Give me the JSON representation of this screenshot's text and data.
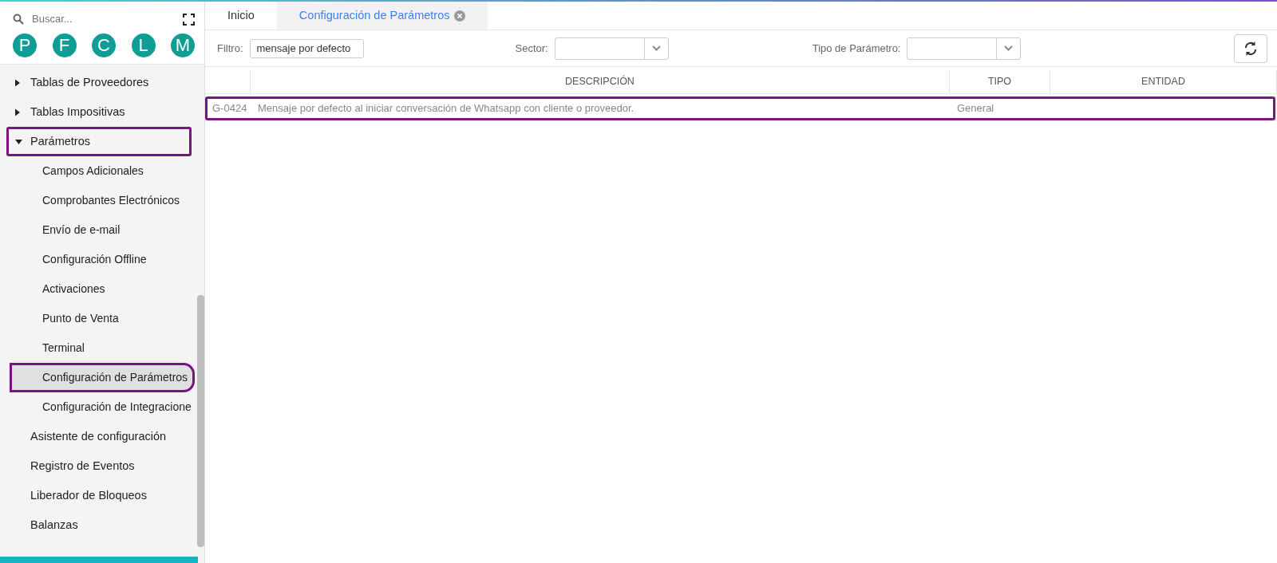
{
  "sidebar": {
    "search": {
      "placeholder": "Buscar..."
    },
    "shortcuts": [
      "P",
      "F",
      "C",
      "L",
      "M"
    ],
    "items": [
      {
        "label": "Tablas de Proveedores",
        "kind": "group",
        "expanded": false,
        "highlighted": false
      },
      {
        "label": "Tablas Impositivas",
        "kind": "group",
        "expanded": false,
        "highlighted": false
      },
      {
        "label": "Parámetros",
        "kind": "group",
        "expanded": true,
        "highlighted": true,
        "children": [
          {
            "label": "Campos Adicionales",
            "selected": false,
            "highlighted": false
          },
          {
            "label": "Comprobantes Electrónicos",
            "selected": false,
            "highlighted": false
          },
          {
            "label": "Envío de e-mail",
            "selected": false,
            "highlighted": false
          },
          {
            "label": "Configuración Offline",
            "selected": false,
            "highlighted": false
          },
          {
            "label": "Activaciones",
            "selected": false,
            "highlighted": false
          },
          {
            "label": "Punto de Venta",
            "selected": false,
            "highlighted": false
          },
          {
            "label": "Terminal",
            "selected": false,
            "highlighted": false
          },
          {
            "label": "Configuración de Parámetros",
            "selected": true,
            "highlighted": true
          },
          {
            "label": "Configuración de Integracione",
            "selected": false,
            "highlighted": false
          }
        ]
      },
      {
        "label": "Asistente de configuración",
        "kind": "link",
        "highlighted": false
      },
      {
        "label": "Registro de Eventos",
        "kind": "link",
        "highlighted": false
      },
      {
        "label": "Liberador de Bloqueos",
        "kind": "link",
        "highlighted": false
      },
      {
        "label": "Balanzas",
        "kind": "link",
        "highlighted": false
      }
    ]
  },
  "tabs": [
    {
      "label": "Inicio",
      "selected": false,
      "closable": false
    },
    {
      "label": "Configuración de Parámetros",
      "selected": true,
      "closable": true
    }
  ],
  "filters": {
    "filter_label": "Filtro:",
    "filter_value": "mensaje por defecto",
    "sector_label": "Sector:",
    "type_label": "Tipo de Parámetro:"
  },
  "table": {
    "columns": [
      "DESCRIPCIÓN",
      "TIPO",
      "ENTIDAD"
    ],
    "rows": [
      {
        "code": "G-0424",
        "description": "Mensaje por defecto al iniciar conversación de Whatsapp con cliente o proveedor.",
        "type": "General",
        "highlighted": true
      }
    ]
  }
}
